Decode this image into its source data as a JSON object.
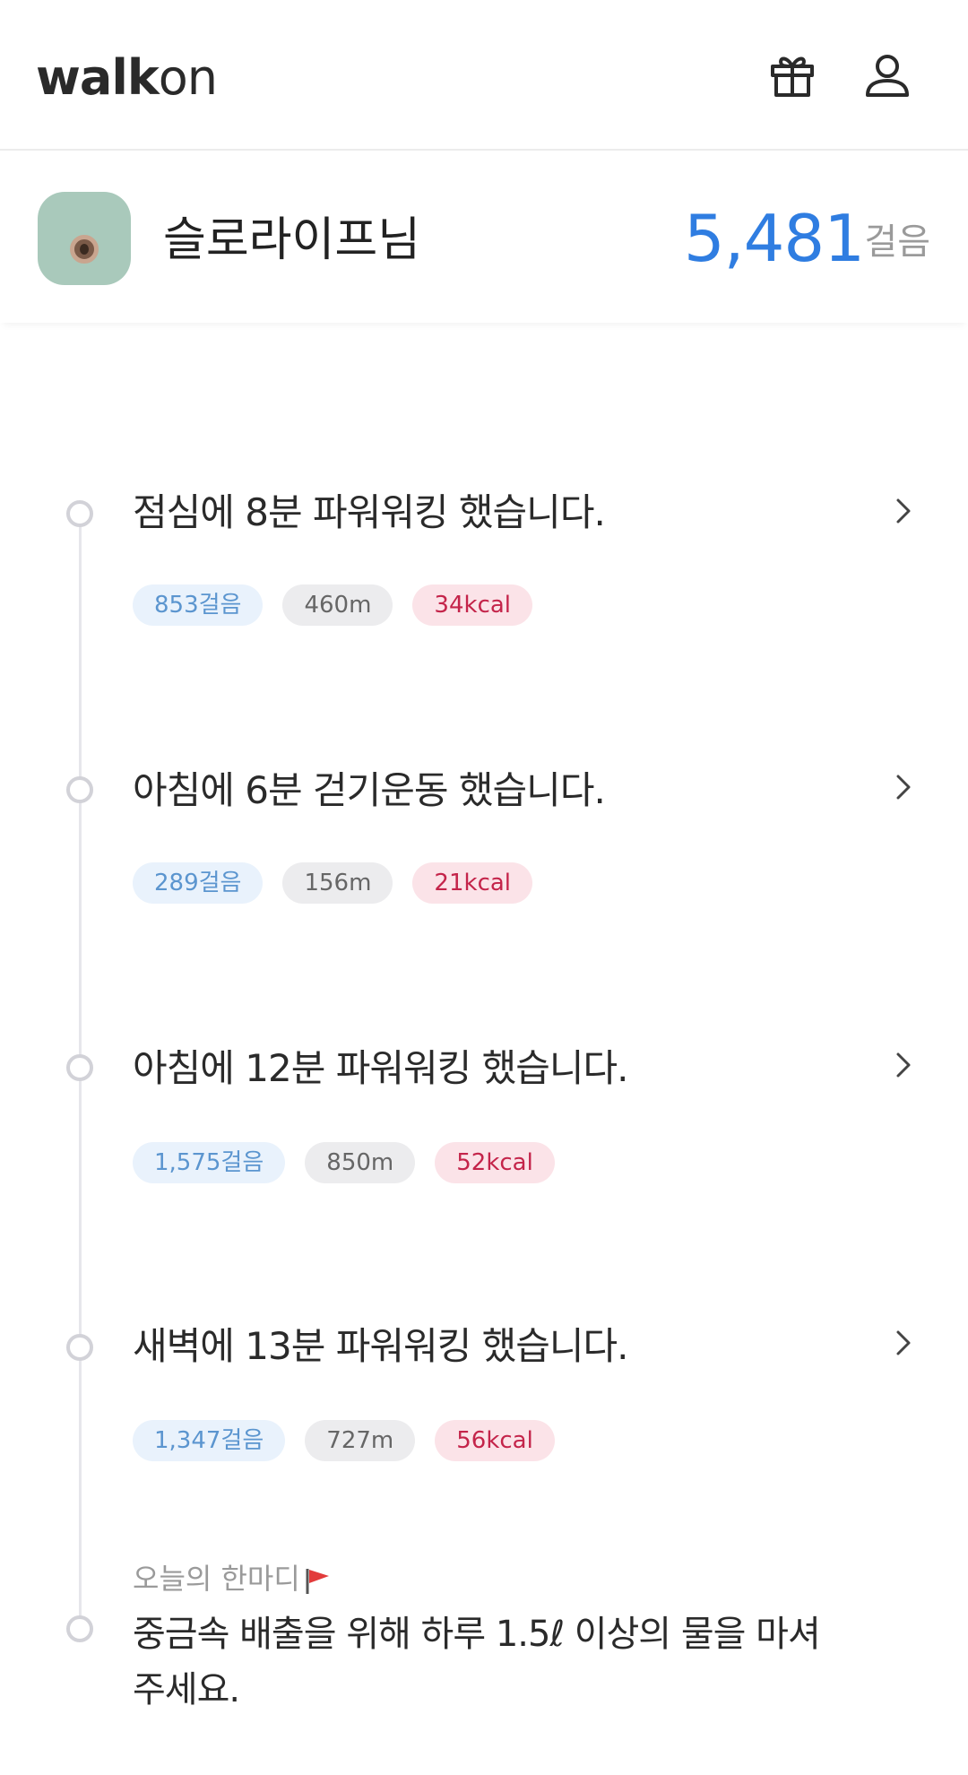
{
  "header": {
    "logo_main": "walk",
    "logo_suffix": "on",
    "icons": [
      "gift-icon",
      "user-icon"
    ]
  },
  "profile": {
    "name": "슬로라이프님",
    "total_steps": "5,481",
    "steps_unit": "걸음"
  },
  "activities": [
    {
      "title": "점심에 8분 파워워킹 했습니다.",
      "steps": "853걸음",
      "distance": "460m",
      "calories": "34kcal"
    },
    {
      "title": "아침에 6분 걷기운동 했습니다.",
      "steps": "289걸음",
      "distance": "156m",
      "calories": "21kcal"
    },
    {
      "title": "아침에 12분 파워워킹 했습니다.",
      "steps": "1,575걸음",
      "distance": "850m",
      "calories": "52kcal"
    },
    {
      "title": "새벽에 13분 파워워킹 했습니다.",
      "steps": "1,347걸음",
      "distance": "727m",
      "calories": "56kcal"
    }
  ],
  "tip": {
    "label": "오늘의 한마디",
    "text": "중금속 배출을 위해 하루 1.5ℓ 이상의 물을 마셔주세요."
  },
  "colors": {
    "accent": "#2f7de1",
    "steps_chip_bg": "#e9f2fc",
    "steps_chip_text": "#5b95cf",
    "distance_chip_bg": "#ececee",
    "calorie_chip_bg": "#fbe3e8",
    "calorie_chip_text": "#c4244a",
    "flag": "#e23b3b"
  }
}
